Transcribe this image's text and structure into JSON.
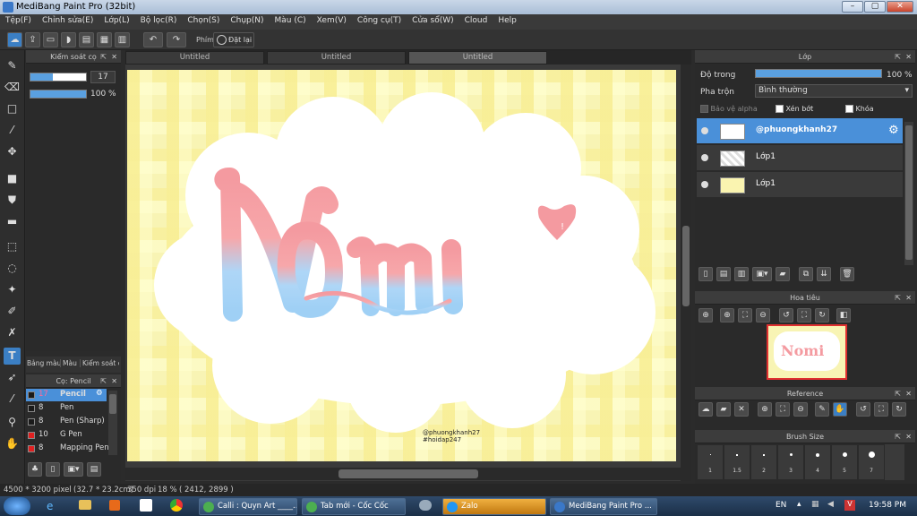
{
  "window": {
    "title": "MediBang Paint Pro (32bit)",
    "min": "–",
    "max": "▢",
    "close": "✕"
  },
  "menu": [
    "Tệp(F)",
    "Chỉnh sửa(E)",
    "Lớp(L)",
    "Bộ lọc(R)",
    "Chọn(S)",
    "Chụp(N)",
    "Màu (C)",
    "Xem(V)",
    "Công cụ(T)",
    "Cửa sổ(W)",
    "Cloud",
    "Help"
  ],
  "toolbar": {
    "phim_label": "Phím",
    "reset_label": "Đặt lại"
  },
  "brush_control": {
    "title": "Kiểm soát cọ",
    "size_value": "17",
    "opacity_value": "100 %"
  },
  "color_tabs": [
    "Bảng màu",
    "Màu",
    "Kiểm soát cọ"
  ],
  "brush_list": {
    "title": "Cọ: Pencil",
    "items": [
      {
        "size": "17",
        "name": "Pencil",
        "color": "#1a1a1a",
        "selected": true
      },
      {
        "size": "8",
        "name": "Pen",
        "color": "#1a1a1a"
      },
      {
        "size": "8",
        "name": "Pen (Sharp)",
        "color": "#1a1a1a"
      },
      {
        "size": "10",
        "name": "G Pen",
        "color": "#e02020"
      },
      {
        "size": "8",
        "name": "Mapping Pen",
        "color": "#e02020"
      }
    ]
  },
  "doc_tabs": [
    "Untitled",
    "Untitled",
    "Untitled"
  ],
  "artwork": {
    "word": "Nomi",
    "signature_line1": "@phuongkhanh27",
    "signature_line2": "#hoidap247"
  },
  "layer_panel": {
    "title": "Lớp",
    "opacity_label": "Độ trong",
    "opacity_value": "100 %",
    "blend_label": "Pha trộn",
    "blend_value": "Bình thường",
    "protect_alpha": "Bảo vệ alpha",
    "clipping": "Xén bớt",
    "lock": "Khóa",
    "layers": [
      {
        "name": "@phuongkhanh27",
        "selected": true
      },
      {
        "name": "Lớp1"
      },
      {
        "name": "Lớp1"
      }
    ]
  },
  "navigator": {
    "title": "Hoa tiêu"
  },
  "reference": {
    "title": "Reference"
  },
  "brush_size": {
    "title": "Brush Size",
    "sizes": [
      "1",
      "1.5",
      "2",
      "3",
      "4",
      "5",
      "7"
    ]
  },
  "status": {
    "dimensions": "4500 * 3200 pixel",
    "cm": "(32.7 * 23.2cm)",
    "dpi": "350 dpi",
    "zoom": "18 %",
    "cursor": "( 2412, 2899 )"
  },
  "taskbar": {
    "tasks": [
      {
        "label": "Calli : Quyn Art ____...",
        "color": "#4caf50"
      },
      {
        "label": "Tab mới - Cốc Cốc",
        "color": "#4caf50"
      },
      {
        "label": "Zalo",
        "color": "#2196f3"
      },
      {
        "label": "MediBang Paint Pro ...",
        "color": "#3a78c8"
      }
    ],
    "lang": "EN",
    "time": "19:58 PM"
  },
  "colors": {
    "accent": "#4a90d9",
    "pink": "#f49aa0",
    "blue": "#a8d4f5",
    "paper": "#f8f4b4"
  }
}
